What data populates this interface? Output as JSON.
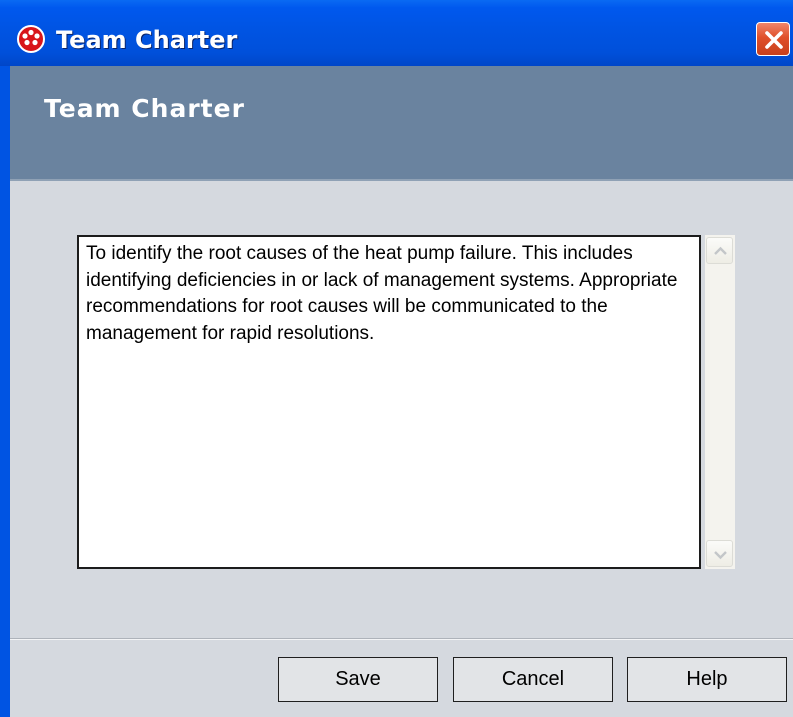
{
  "window": {
    "title": "Team Charter",
    "icon": "red-circle-dots-icon",
    "close_icon": "close-icon"
  },
  "header": {
    "title": "Team Charter"
  },
  "charter": {
    "text": "To identify the root causes of the heat pump failure. This includes identifying deficiencies in or lack of management systems. Appropriate recommendations for root causes will be communicated to the management for rapid resolutions."
  },
  "scrollbar": {
    "up_icon": "chevron-up-icon",
    "down_icon": "chevron-down-icon"
  },
  "buttons": {
    "save_label": "Save",
    "cancel_label": "Cancel",
    "help_label": "Help"
  },
  "colors": {
    "titlebar": "#0054e3",
    "header_band": "#6a839f",
    "client_bg": "#d5d9df",
    "close_button": "#e0502a"
  }
}
